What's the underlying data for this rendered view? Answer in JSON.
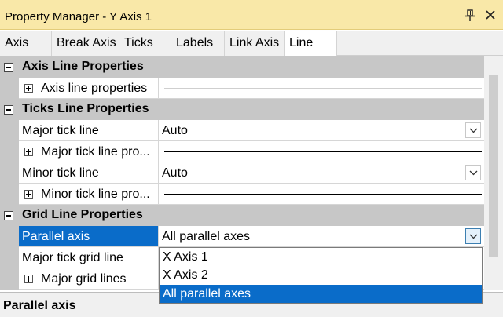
{
  "window": {
    "title": "Property Manager - Y Axis 1"
  },
  "tabs": [
    {
      "label": "Axis"
    },
    {
      "label": "Break Axis"
    },
    {
      "label": "Ticks"
    },
    {
      "label": "Labels"
    },
    {
      "label": "Link Axis"
    },
    {
      "label": "Line",
      "active": true
    }
  ],
  "sections": {
    "axis_line": {
      "title": "Axis Line Properties",
      "rows": [
        {
          "name": "Axis line properties"
        }
      ]
    },
    "ticks_line": {
      "title": "Ticks Line Properties",
      "rows": [
        {
          "name": "Major tick line",
          "value": "Auto"
        },
        {
          "name": "Major tick line pro..."
        },
        {
          "name": "Minor tick line",
          "value": "Auto"
        },
        {
          "name": "Minor tick line pro..."
        }
      ]
    },
    "grid_line": {
      "title": "Grid Line Properties",
      "rows": [
        {
          "name": "Parallel axis",
          "value": "All parallel axes",
          "selected": true
        },
        {
          "name": "Major tick grid line"
        },
        {
          "name": "Major grid lines"
        }
      ]
    }
  },
  "dropdown": {
    "options": [
      "X Axis 1",
      "X Axis 2",
      "All parallel axes"
    ],
    "selected": "All parallel axes"
  },
  "description": {
    "title": "Parallel axis"
  },
  "colors": {
    "title_bar": "#f9e8a8",
    "section_header": "#c7c7c7",
    "selection": "#0a6cc9"
  }
}
